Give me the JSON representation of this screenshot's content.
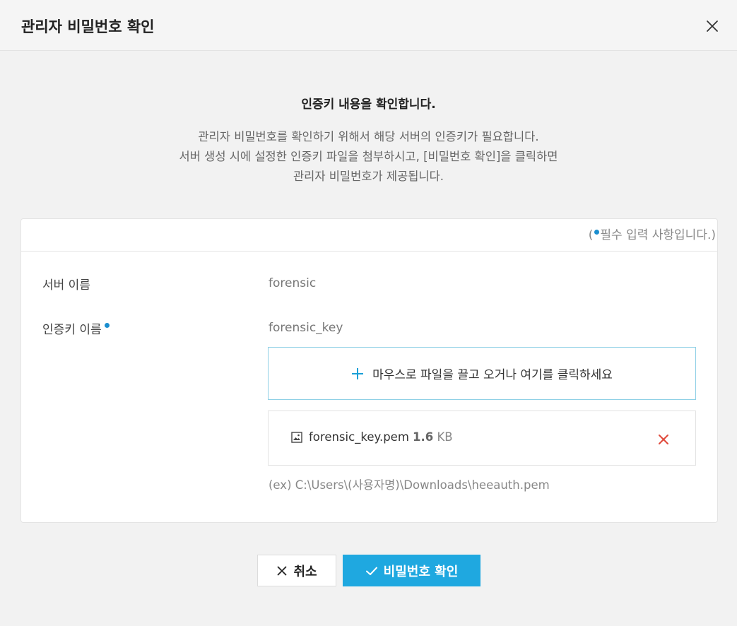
{
  "dialog": {
    "title": "관리자 비밀번호 확인"
  },
  "intro": {
    "title": "인증키 내용을 확인합니다.",
    "lines": [
      "관리자 비밀번호를 확인하기 위해서 해당 서버의 인증키가 필요합니다.",
      "서버 생성 시에 설정한 인증키 파일을 첨부하시고, [비밀번호 확인]을 클릭하면",
      "관리자 비밀번호가 제공됩니다."
    ]
  },
  "form": {
    "required_note_open": "(",
    "required_note_text": "필수 입력 사항입니다.)",
    "server_name_label": "서버 이름",
    "server_name_value": "forensic",
    "auth_key_label": "인증키 이름",
    "auth_key_value": "forensic_key",
    "dropzone_text": "마우스로 파일을 끌고 오거나 여기를 클릭하세요",
    "file": {
      "name": "forensic_key.pem",
      "size_number": "1.6",
      "size_unit": "KB"
    },
    "example_path": "(ex) C:\\Users\\(사용자명)\\Downloads\\heeauth.pem"
  },
  "buttons": {
    "cancel_label": "취소",
    "confirm_label": "비밀번호 확인"
  },
  "colors": {
    "accent": "#1fa8e0",
    "required_dot": "#1a8ecf",
    "remove_icon": "#e0483a",
    "background": "#f2f2f2"
  },
  "icons": {
    "close": "close-icon",
    "plus": "plus-icon",
    "file": "image-file-icon",
    "remove": "remove-file-icon",
    "cancel": "x-icon",
    "confirm": "check-icon"
  }
}
